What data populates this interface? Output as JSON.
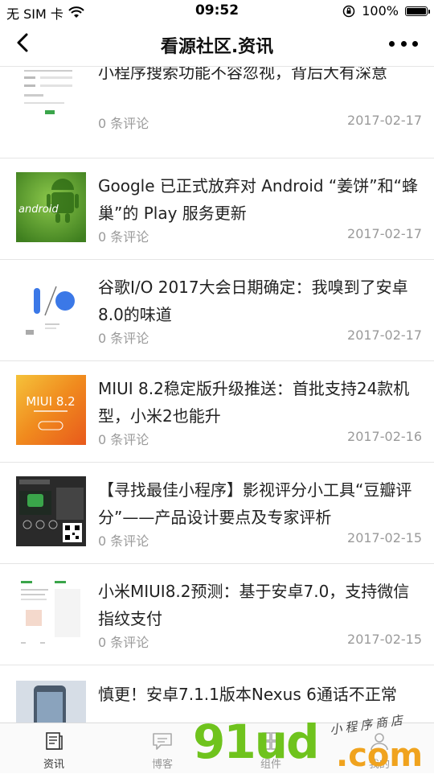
{
  "status_bar": {
    "carrier": "无 SIM 卡",
    "time": "09:52",
    "battery": "100%"
  },
  "nav": {
    "title": "看源社区.资讯"
  },
  "articles": [
    {
      "title": "小程序搜索功能不容忽视，背后大有深意",
      "comments": "0 条评论",
      "date": "2017-02-17",
      "thumb": "screenshot-form"
    },
    {
      "title": "Google 已正式放弃对 Android “姜饼”和“蜂巢”的 Play 服务更新",
      "comments": "0 条评论",
      "date": "2017-02-17",
      "thumb": "android-robot"
    },
    {
      "title": "谷歌I/O 2017大会日期确定：我嗅到了安卓8.0的味道",
      "comments": "0 条评论",
      "date": "2017-02-17",
      "thumb": "google-io-logo"
    },
    {
      "title": "MIUI 8.2稳定版升级推送：首批支持24款机型，小米2也能升",
      "comments": "0 条评论",
      "date": "2017-02-16",
      "thumb": "miui-banner"
    },
    {
      "title": "【寻找最佳小程序】影视评分小工具“豆瓣评分”——产品设计要点及专家评析",
      "comments": "0 条评论",
      "date": "2017-02-15",
      "thumb": "douban-app"
    },
    {
      "title": "小米MIUI8.2预测：基于安卓7.0，支持微信指纹支付",
      "comments": "0 条评论",
      "date": "2017-02-15",
      "thumb": "miui-settings"
    },
    {
      "title": "慎更！安卓7.1.1版本Nexus 6通话不正常",
      "comments": "",
      "date": "",
      "thumb": "nexus-phone"
    }
  ],
  "thumb_texts": {
    "android": "android",
    "miui": "MIUI 8.2"
  },
  "tabs": [
    {
      "label": "资讯",
      "icon": "news-icon",
      "active": true
    },
    {
      "label": "博客",
      "icon": "chat-icon",
      "active": false
    },
    {
      "label": "组件",
      "icon": "component-icon",
      "active": false
    },
    {
      "label": "我的",
      "icon": "profile-icon",
      "active": false
    }
  ],
  "watermark": {
    "brand": "91ud",
    "domain": ".com",
    "script": "小程序商店"
  },
  "colors": {
    "android_green": "#6fb23a",
    "miui_orange": "#f08a1e",
    "watermark_green": "#6fc31d",
    "watermark_orange": "#f0a31e"
  }
}
